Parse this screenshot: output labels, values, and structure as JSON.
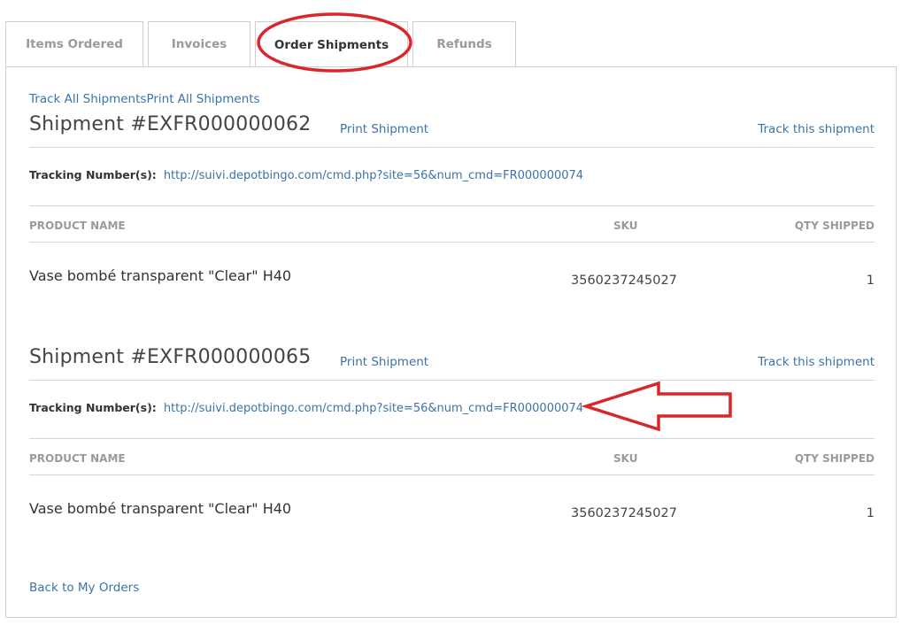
{
  "tabs": [
    {
      "label": "Items Ordered",
      "active": false
    },
    {
      "label": "Invoices",
      "active": false
    },
    {
      "label": "Order Shipments",
      "active": true
    },
    {
      "label": "Refunds",
      "active": false
    }
  ],
  "top_links": {
    "track_all": "Track All Shipments",
    "print_all": "Print All Shipments"
  },
  "shipments": [
    {
      "title": "Shipment #EXFR000000062",
      "print_label": "Print Shipment",
      "track_label": "Track this shipment",
      "tracking_label": "Tracking Number(s):",
      "tracking_url": "http://suivi.depotbingo.com/cmd.php?site=56&num_cmd=FR000000074",
      "columns": [
        "PRODUCT NAME",
        "SKU",
        "QTY SHIPPED"
      ],
      "rows": [
        {
          "product": "Vase bombé transparent \"Clear\" H40",
          "sku": "3560237245027",
          "qty": "1"
        }
      ]
    },
    {
      "title": "Shipment #EXFR000000065",
      "print_label": "Print Shipment",
      "track_label": "Track this shipment",
      "tracking_label": "Tracking Number(s):",
      "tracking_url": "http://suivi.depotbingo.com/cmd.php?site=56&num_cmd=FR000000074",
      "columns": [
        "PRODUCT NAME",
        "SKU",
        "QTY SHIPPED"
      ],
      "rows": [
        {
          "product": "Vase bombé transparent \"Clear\" H40",
          "sku": "3560237245027",
          "qty": "1"
        }
      ]
    }
  ],
  "back_link": "Back to My Orders",
  "colors": {
    "link": "#3b73a8",
    "annotation": "#d9262c",
    "border": "#cfcfcf"
  }
}
